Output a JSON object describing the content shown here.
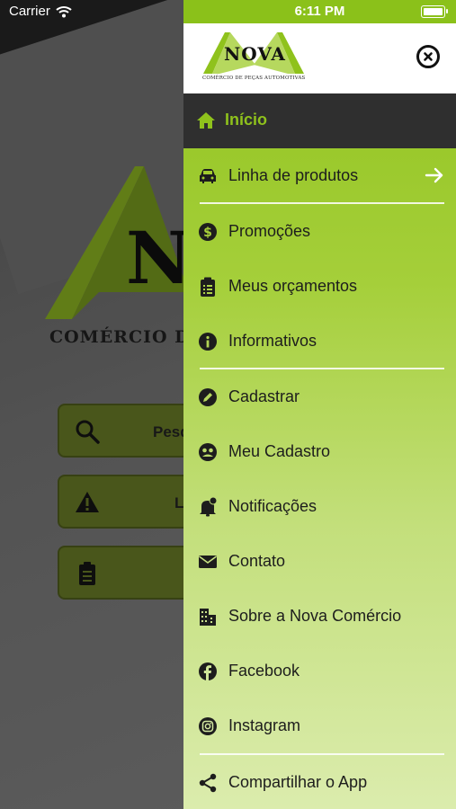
{
  "status_bar": {
    "carrier": "Carrier",
    "time": "6:11 PM"
  },
  "background": {
    "logo_subtitle": "COMÉRCIO DE",
    "buttons": [
      {
        "label": "Pesq",
        "icon": "search-icon"
      },
      {
        "label": "L",
        "icon": "warning-icon"
      },
      {
        "label": "",
        "icon": "clipboard-icon"
      }
    ]
  },
  "drawer": {
    "logo": {
      "name": "NOVA",
      "subtitle": "COMÉRCIO DE PEÇAS AUTOMOTIVAS"
    },
    "home": {
      "label": "Início",
      "icon": "home-icon"
    },
    "items": [
      {
        "label": "Linha de produtos",
        "icon": "car-icon"
      },
      {
        "label": "Promoções",
        "icon": "dollar-circle-icon"
      },
      {
        "label": "Meus orçamentos",
        "icon": "clipboard-list-icon"
      },
      {
        "label": "Informativos",
        "icon": "info-circle-icon"
      },
      {
        "label": "Cadastrar",
        "icon": "pencil-circle-icon"
      },
      {
        "label": "Meu Cadastro",
        "icon": "user-circle-icon"
      },
      {
        "label": "Notificações",
        "icon": "bell-icon"
      },
      {
        "label": "Contato",
        "icon": "envelope-icon"
      },
      {
        "label": "Sobre a Nova Comércio",
        "icon": "building-icon"
      },
      {
        "label": "Facebook",
        "icon": "facebook-icon"
      },
      {
        "label": "Instagram",
        "icon": "instagram-icon"
      },
      {
        "label": "Compartilhar o App",
        "icon": "share-icon"
      }
    ]
  },
  "colors": {
    "accent": "#8fc21c",
    "header_bg": "#2f2f2f"
  }
}
